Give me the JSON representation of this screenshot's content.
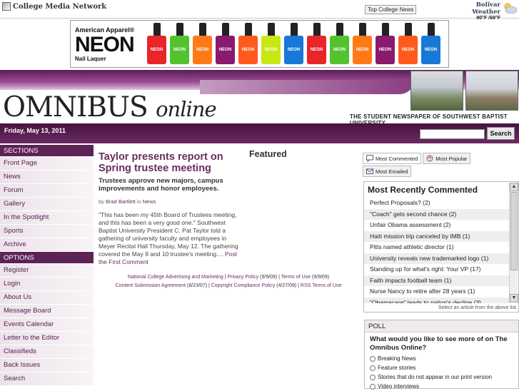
{
  "topbar": {
    "network_name": "College Media Network",
    "top_college_news": "Top College News",
    "weather_city": "Bolivar Weather",
    "weather_temp": "90°F /69°F"
  },
  "ad": {
    "brand_line1": "American Apparel®",
    "brand_line2": "NEON",
    "brand_line3": "Nail Laquer",
    "bottle_label": "NEON",
    "bottle_colors": [
      "#e8262a",
      "#53c22c",
      "#ff7a17",
      "#8a1a6f",
      "#ff5a1c",
      "#c7e815",
      "#1878d6",
      "#e8262a",
      "#53c22c",
      "#ff7a17",
      "#8a1a6f",
      "#ff5a1c",
      "#1878d6"
    ]
  },
  "masthead": {
    "title_main": "OMNIBUS",
    "title_online": "online",
    "subtitle": "THE STUDENT NEWSPAPER OF SOUTHWEST BAPTIST UNIVERSITY"
  },
  "navbar": {
    "date": "Friday, May 13, 2011",
    "search_button": "Search"
  },
  "sidebar": {
    "sections_header": "SECTIONS",
    "sections": [
      "Front Page",
      "News",
      "Forum",
      "Gallery",
      "In the Spotlight",
      "Sports",
      "Archive"
    ],
    "options_header": "OPTIONS",
    "options": [
      "Register",
      "Login",
      "About Us",
      "Message Board",
      "Events Calendar",
      "Letter to the Editor",
      "Classifieds",
      "Back Issues",
      "Search"
    ]
  },
  "article": {
    "title": "Taylor presents report on Spring trustee meeting",
    "dek": "Trustees approve new majors, campus improvements and honor employees.",
    "by": "by",
    "author": "Brad Bartlett",
    "in": "in",
    "section": "News",
    "body": "\"This has been my 45th Board of Trustees meeting, and this has been a very good one.\" Southwest Baptist University President C. Pat Taylor told a gathering of university faculty and employees in Meyer Recital Hall Thursday, May 12. The gathering covered the May 9 and 10 trustee's meeting....",
    "comment_link": "Post the First Comment"
  },
  "featured": {
    "label": "Featured"
  },
  "footer": {
    "l1": "National College Advertising and Marketing",
    "sep": " | ",
    "l2": "Privacy Policy",
    "d2": " (9/9/09)",
    "l3": "Terms of Use",
    "d3": " (9/9/09)",
    "l4": "Content Submission Agreement",
    "d4": " (8/23/07)",
    "l5": "Copyright Compliance Policy",
    "d5": " (4/27/09)",
    "l6": "RSS Terms of Use"
  },
  "tabs": {
    "most_commented": "Most Commented",
    "most_popular": "Most Popular",
    "most_emailed": "Most Emailed"
  },
  "commented": {
    "title": "Most Recently Commented",
    "items": [
      "Perfect Proposals? (2)",
      "\"Coach\" gets second chance (2)",
      "Unfair Obama assessment (2)",
      "Haiti mission trip canceled by IMB (1)",
      "Pitts named athletic director (1)",
      "University reveals new trademarked logo (1)",
      "Standing up for what's right: Your VP (17)",
      "Faith impacts football team (1)",
      "Nurse Nancy to retire after 28 years (1)",
      "\"Obamacare\" leads to nation's decline (3)"
    ],
    "hint": "Select an article from the above list"
  },
  "poll": {
    "header": "POLL",
    "question": "What would you like to see more of on The Omnibus Online?",
    "options": [
      "Breaking News",
      "Feature stories",
      "Stories that do not appear in our print version",
      "Video interviews"
    ]
  }
}
